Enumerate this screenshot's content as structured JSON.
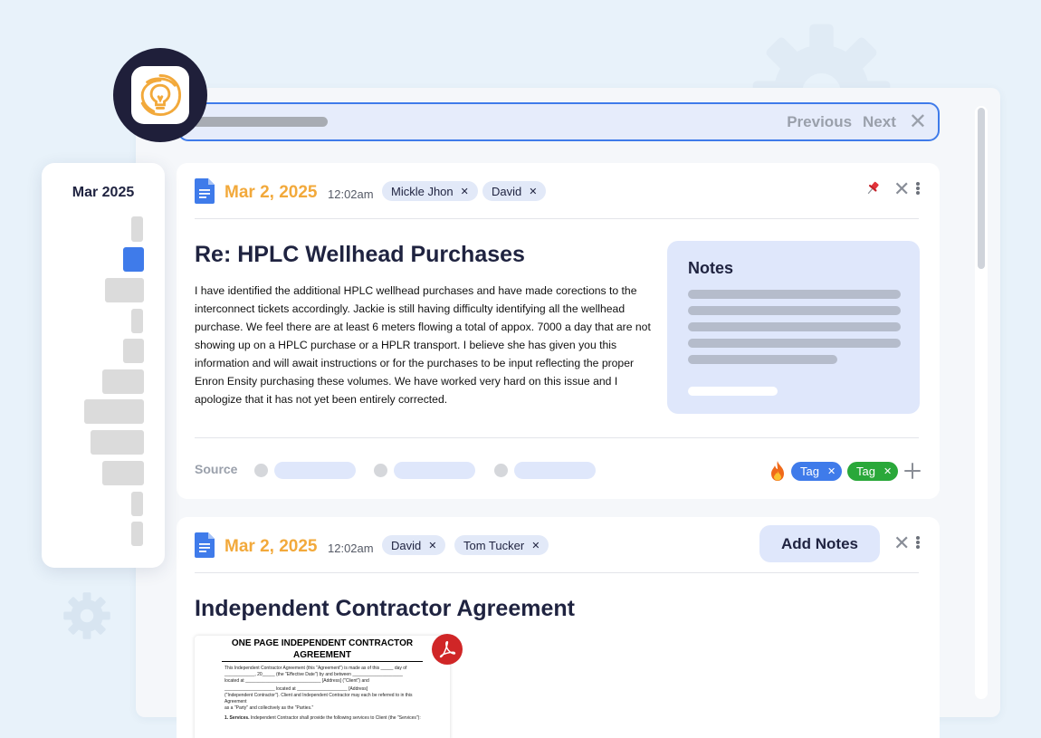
{
  "search": {
    "prev_label": "Previous",
    "next_label": "Next",
    "close_glyph": "✕"
  },
  "timeline": {
    "month_label": "Mar 2025"
  },
  "cards": [
    {
      "icon": "google-doc-icon",
      "date": "Mar 2, 2025",
      "time": "12:02am",
      "participants": [
        "Mickle Jhon",
        "David"
      ],
      "title": "Re: HPLC Wellhead Purchases",
      "body": "I have identified the additional HPLC wellhead purchases and have made corections to the interconnect tickets accordingly. Jackie is still having difficulty identifying all the wellhead purchase. We feel there are at least 6 meters flowing a total of appox. 7000 a day that are not showing up on a HPLC purchase or a HPLR transport. I believe she has given you this information and will await instructions or for the purchases to be input reflecting the proper Enron Ensity purchasing these volumes. We have worked very hard on this issue and I apologize that it has not yet been entirely corrected.",
      "notes_title": "Notes",
      "source_label": "Source",
      "tags": [
        "Tag",
        "Tag"
      ]
    },
    {
      "icon": "google-doc-icon",
      "date": "Mar 2, 2025",
      "time": "12:02am",
      "participants": [
        "David",
        "Tom Tucker"
      ],
      "add_notes_label": "Add Notes",
      "title": "Independent Contractor Agreement",
      "pdf": {
        "heading_line1": "ONE PAGE INDEPENDENT CONTRACTOR",
        "heading_line2": "AGREEMENT",
        "line1": "This Independent Contractor Agreement (this \"Agreement\") is made as of this _____ day of",
        "line2": "____________, 20_____ (the \"Effective Date\") by and between ____________________",
        "line3": "located at ______________________________ [Address] (\"Client\") and",
        "line4": "____________________ located at ____________________ [Address]",
        "line5": "(\"Independent Contractor\"). Client and Independent Contractor may each be referred to in this Agreement",
        "line6": "as a \"Party\" and collectively as the \"Parties.\"",
        "line7_bold": "1. Services.",
        "line7_rest": " Independent Contractor shall provide the following services to Client (the \"Services\"):"
      }
    }
  ],
  "colors": {
    "accent_blue": "#3f7bea",
    "date_orange": "#f2a93b",
    "tag_green": "#2aa83a",
    "pdf_red": "#d02627",
    "logo_gold": "#f2a93b"
  }
}
